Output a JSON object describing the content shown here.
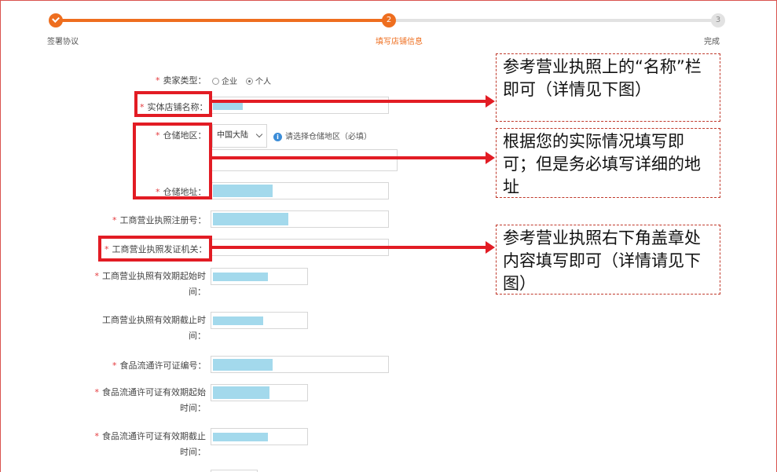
{
  "progress": {
    "steps": [
      {
        "number": "1",
        "label": "签署协议"
      },
      {
        "number": "2",
        "label": "填写店铺信息"
      },
      {
        "number": "3",
        "label": "完成"
      }
    ]
  },
  "form": {
    "seller_type": {
      "label": "卖家类型：",
      "options": [
        "企业",
        "个人"
      ],
      "selected": "个人"
    },
    "store_name": {
      "label": "实体店铺名称："
    },
    "warehouse_region": {
      "label": "仓储地区：",
      "value": "中国大陆",
      "hint": "请选择仓储地区（必填）"
    },
    "warehouse_address": {
      "label": "仓储地址："
    },
    "license_number": {
      "label": "工商营业执照注册号："
    },
    "license_authority": {
      "label": "工商营业执照发证机关："
    },
    "license_start": {
      "label": "工商营业执照有效期起始时间："
    },
    "license_end": {
      "label": "工商营业执照有效期截止时间："
    },
    "food_permit_number": {
      "label": "食品流通许可证编号："
    },
    "food_permit_start": {
      "label": "食品流通许可证有效期起始时间："
    },
    "food_permit_end": {
      "label": "食品流通许可证有效期截止时间："
    }
  },
  "notes": {
    "store_name": "参考营业执照上的“名称”栏即可（详情见下图）",
    "warehouse": "根据您的实际情况填写即可；但是务必填写详细的地址",
    "authority": "参考营业执照右下角盖章处内容填写即可（详情请见下图）"
  },
  "colors": {
    "accent": "#ee6e1f",
    "annotation": "#e21c24",
    "required": "#e4393c"
  }
}
